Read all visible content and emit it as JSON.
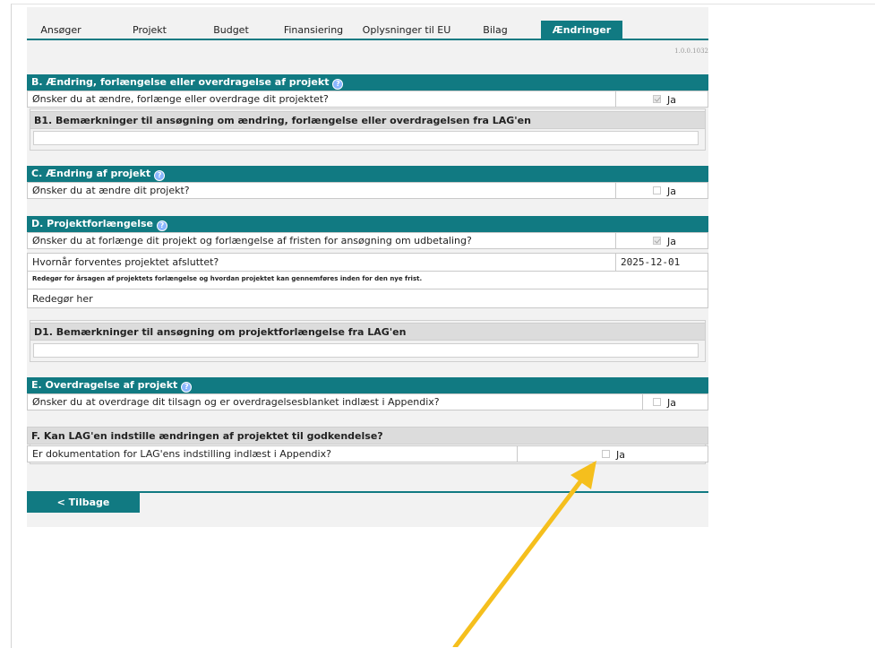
{
  "tabs": [
    "Ansøger",
    "Projekt",
    "Budget",
    "Finansiering",
    "Oplysninger til EU",
    "Bilag",
    "Ændringer"
  ],
  "version": "1.0.0.1032",
  "sectionB": {
    "title": "B. Ændring, forlængelse eller overdragelse af projekt",
    "question": "Ønsker du at ændre, forlænge eller overdrage dit projektet?",
    "checked": true,
    "ja": "Ja",
    "sub": "B1. Bemærkninger til ansøgning om ændring, forlængelse eller overdragelsen fra LAG'en",
    "sub_value": ""
  },
  "sectionC": {
    "title": "C. Ændring af projekt",
    "question": "Ønsker du at ændre dit projekt?",
    "checked": false,
    "ja": "Ja"
  },
  "sectionD": {
    "title": "D. Projektforlængelse",
    "question": "Ønsker du at forlænge dit projekt og forlængelse af fristen for ansøgning om udbetaling?",
    "checked": true,
    "ja": "Ja",
    "date_question": "Hvornår forventes projektet afsluttet?",
    "date_value": "2025-12-01",
    "explain_label": "Redegør for årsagen af projektets forlængelse og hvordan projektet kan gennemføres inden for den nye frist.",
    "explain_value": "Redegør her",
    "sub": "D1. Bemærkninger til ansøgning om projektforlængelse fra LAG'en",
    "sub_value": ""
  },
  "sectionE": {
    "title": "E. Overdragelse af projekt",
    "question": "Ønsker du at overdrage dit tilsagn og er overdragelsesblanket indlæst i Appendix?",
    "checked": false,
    "ja": "Ja"
  },
  "sectionF": {
    "title": "F. Kan LAG'en indstille ændringen af projektet til godkendelse?",
    "question": "Er dokumentation for LAG'ens indstilling indlæst i Appendix?",
    "checked": false,
    "ja": "Ja"
  },
  "back_label": "< Tilbage",
  "colors": {
    "teal": "#117a82",
    "arrow": "#f5bf1d"
  }
}
